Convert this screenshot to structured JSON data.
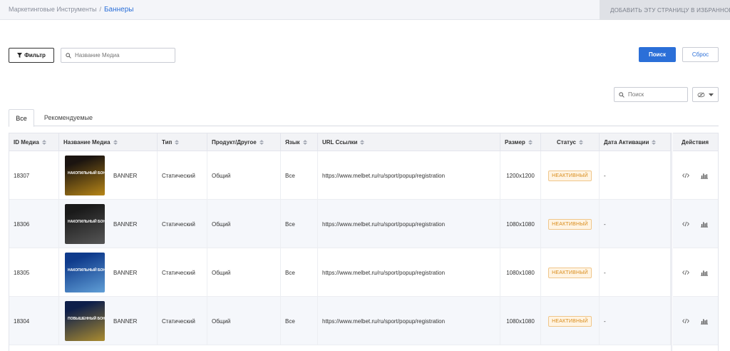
{
  "breadcrumb": {
    "parent": "Маркетинговые Инструменты",
    "separator": "/",
    "current": "Баннеры"
  },
  "favorite": {
    "label": "ДОБАВИТЬ ЭТУ СТРАНИЦУ В ИЗБРАННОЕ",
    "icon": "heart-icon"
  },
  "filters": {
    "filter_label": "Фильтр",
    "filter_icon": "funnel-icon",
    "media_name_placeholder": "Название Медиа",
    "search_label": "Поиск",
    "reset_label": "Сброс"
  },
  "table_search": {
    "placeholder": "Поиск"
  },
  "tabs": [
    {
      "label": "Все",
      "active": true
    },
    {
      "label": "Рекомендуемые",
      "active": false
    }
  ],
  "columns": {
    "id": "ID Медиа",
    "name": "Название Медиа",
    "type": "Тип",
    "product": "Продукт/Другое",
    "lang": "Язык",
    "url": "URL Ссылки",
    "size": "Размер",
    "status": "Статус",
    "activation": "Дата Активации",
    "actions": "Действия"
  },
  "rows": [
    {
      "id": "18307",
      "media_type": "BANNER",
      "type": "Статический",
      "product": "Общий",
      "lang": "Все",
      "url": "https://www.melbet.ru/ru/sport/popup/registration",
      "size": "1200x1200",
      "status": "НЕАКТИВНЫЙ",
      "activation": "-",
      "thumb_colors": [
        "#1b1410",
        "#f2b11a"
      ],
      "thumb_text": "НАКОПИЛЬНЫЙ БОНУС"
    },
    {
      "id": "18306",
      "media_type": "BANNER",
      "type": "Статический",
      "product": "Общий",
      "lang": "Все",
      "url": "https://www.melbet.ru/ru/sport/popup/registration",
      "size": "1080x1080",
      "status": "НЕАКТИВНЫЙ",
      "activation": "-",
      "thumb_colors": [
        "#1a1a1a",
        "#6d6d6d"
      ],
      "thumb_text": "НАКОПИЛЬНЫЙ БОНУС"
    },
    {
      "id": "18305",
      "media_type": "BANNER",
      "type": "Статический",
      "product": "Общий",
      "lang": "Все",
      "url": "https://www.melbet.ru/ru/sport/popup/registration",
      "size": "1080x1080",
      "status": "НЕАКТИВНЫЙ",
      "activation": "-",
      "thumb_colors": [
        "#0f3b8c",
        "#7fc4f2"
      ],
      "thumb_text": "НАКОПИЛЬНЫЙ БОНУС"
    },
    {
      "id": "18304",
      "media_type": "BANNER",
      "type": "Статический",
      "product": "Общий",
      "lang": "Все",
      "url": "https://www.melbet.ru/ru/sport/popup/registration",
      "size": "1080x1080",
      "status": "НЕАКТИВНЫЙ",
      "activation": "-",
      "thumb_colors": [
        "#0e1f4a",
        "#e6b526"
      ],
      "thumb_text": "ПОВЫШЕННЫЙ БОНУС"
    }
  ],
  "colors": {
    "accent": "#2b6fd8",
    "status_inactive": "#d98b1a",
    "row_alt": "#f5f7fb"
  }
}
